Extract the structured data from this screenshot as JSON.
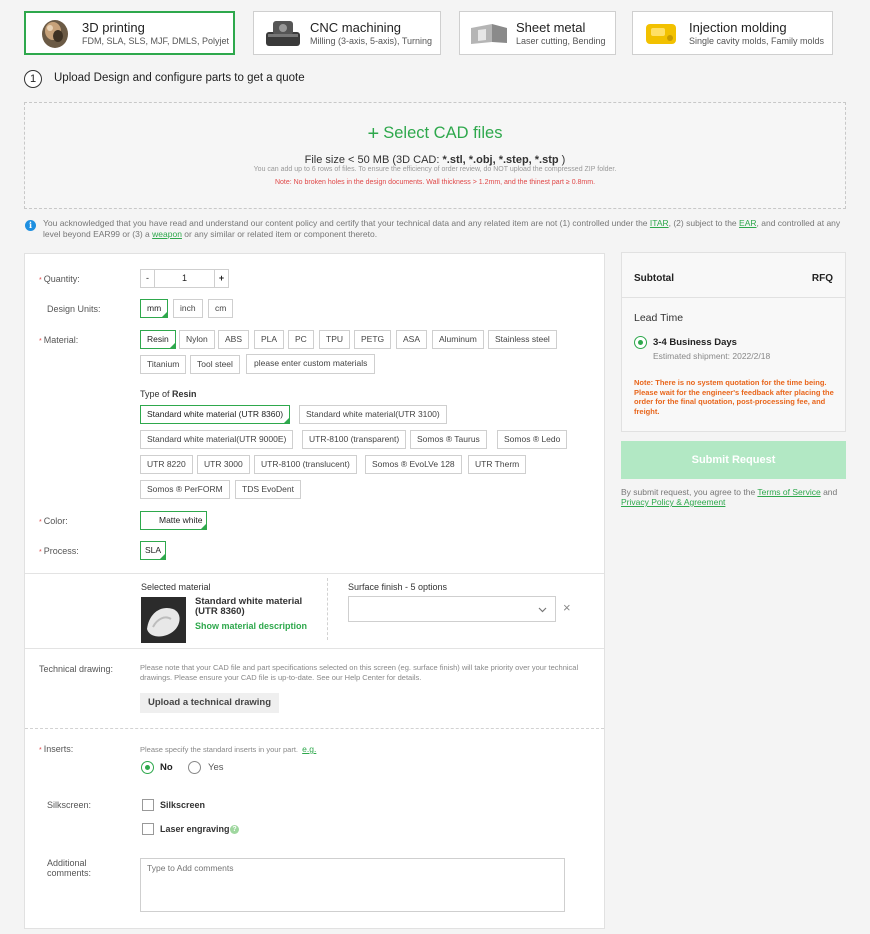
{
  "services": [
    {
      "title": "3D printing",
      "subtitle": "FDM, SLA, SLS, MJF, DMLS, Polyjet",
      "icon": "resin-sculpture-icon",
      "active": true
    },
    {
      "title": "CNC machining",
      "subtitle": "Milling (3-axis, 5-axis), Turning",
      "icon": "cnc-part-icon",
      "active": false
    },
    {
      "title": "Sheet metal",
      "subtitle": "Laser cutting, Bending",
      "icon": "sheet-metal-icon",
      "active": false
    },
    {
      "title": "Injection molding",
      "subtitle": "Single cavity molds, Family molds",
      "icon": "mold-part-icon",
      "active": false
    }
  ],
  "step": {
    "number": "1",
    "text": "Upload Design and configure parts to get a quote"
  },
  "upload": {
    "select_label": "Select CAD files",
    "plus": "+",
    "size_prefix": "File size < 50 MB (3D CAD: ",
    "formats": "*.stl, *.obj, *.step, *.stp",
    "size_suffix": " )",
    "hint": "You can add up to 6 rows of files. To ensure the efficiency of order review, do NOT upload the compressed ZIP folder.",
    "warning": "Note: No broken holes in the design documents. Wall thickness > 1.2mm, and the thinest part ≥ 0.8mm."
  },
  "ack": {
    "t1": "You acknowledged that you have read and understand our content policy and certify that your technical data and any related item are not (1) controlled under the ",
    "itar": "ITAR",
    "t2": ", (2) subject to the ",
    "ear": "EAR",
    "t3": ", and controlled at any level beyond EAR99 or (3) a ",
    "weapon": "weapon",
    "t4": " or any similar or related item or component thereto."
  },
  "form": {
    "quantity_label": "Quantity:",
    "qty_minus": "-",
    "qty_value": "1",
    "qty_plus": "+",
    "units_label": "Design Units:",
    "units": [
      "mm",
      "inch",
      "cm"
    ],
    "material_label": "Material:",
    "materials": [
      "Resin",
      "Nylon",
      "ABS",
      "PLA",
      "PC",
      "TPU",
      "PETG",
      "ASA",
      "Aluminum",
      "Stainless steel",
      "Titanium",
      "Tool steel",
      "please enter custom materials"
    ],
    "type_of_prefix": "Type of ",
    "type_of_name": "Resin",
    "resin_types": [
      "Standard white material (UTR 8360)",
      "Standard white material(UTR 3100)",
      "Standard white material(UTR 9000E)",
      "UTR-8100 (transparent)",
      "Somos ® Taurus",
      "Somos ® Ledo",
      "UTR 8220",
      "UTR 3000",
      "UTR-8100 (translucent)",
      "Somos ® EvoLVe 128",
      "UTR Therm",
      "Somos ® PerFORM",
      "TDS EvoDent"
    ],
    "color_label": "Color:",
    "color_value": "Matte white",
    "process_label": "Process:",
    "process_value": "SLA",
    "selected_material_label": "Selected material",
    "selected_material_name": "Standard white material (UTR 8360)",
    "show_description": "Show material description",
    "surface_label": "Surface finish - 5 options",
    "surface_value": "",
    "surface_clear": "×",
    "tech_label": "Technical drawing:",
    "tech_note": "Please note that your CAD file and part specifications selected on this screen (eg. surface finish) will take priority over your technical drawings. Please ensure your CAD file is up-to-date. See our Help Center for details.",
    "tech_button": "Upload a technical drawing",
    "inserts_label": "Inserts:",
    "inserts_hint": "Please specify the standard inserts in your part.",
    "inserts_eg": "e.g.",
    "inserts_no": "No",
    "inserts_yes": "Yes",
    "silkscreen_label": "Silkscreen:",
    "silkscreen_opt": "Silkscreen",
    "laser_opt": "Laser engraving",
    "comments_label": "Additional comments:",
    "comments_placeholder": "Type to Add comments"
  },
  "summary": {
    "subtotal_label": "Subtotal",
    "subtotal_value": "RFQ",
    "lead_time_label": "Lead Time",
    "lead_option": "3-4 Business Days",
    "shipment": "Estimated shipment: 2022/2/18",
    "note": "Note: There is no system quotation for the time being. Please wait for the engineer's feedback after placing the order for the final quotation, post-processing fee, and freight.",
    "submit": "Submit Request",
    "terms_prefix": "By submit request, you agree to the ",
    "terms_link": "Terms of Service",
    "terms_and": " and ",
    "privacy_link": "Privacy Policy & Agreement"
  },
  "colors": {
    "accent": "#2ea84c",
    "submit_disabled": "#b2e8c4",
    "warning": "#e04848",
    "note": "#e8661c",
    "info": "#1e8fe0"
  }
}
